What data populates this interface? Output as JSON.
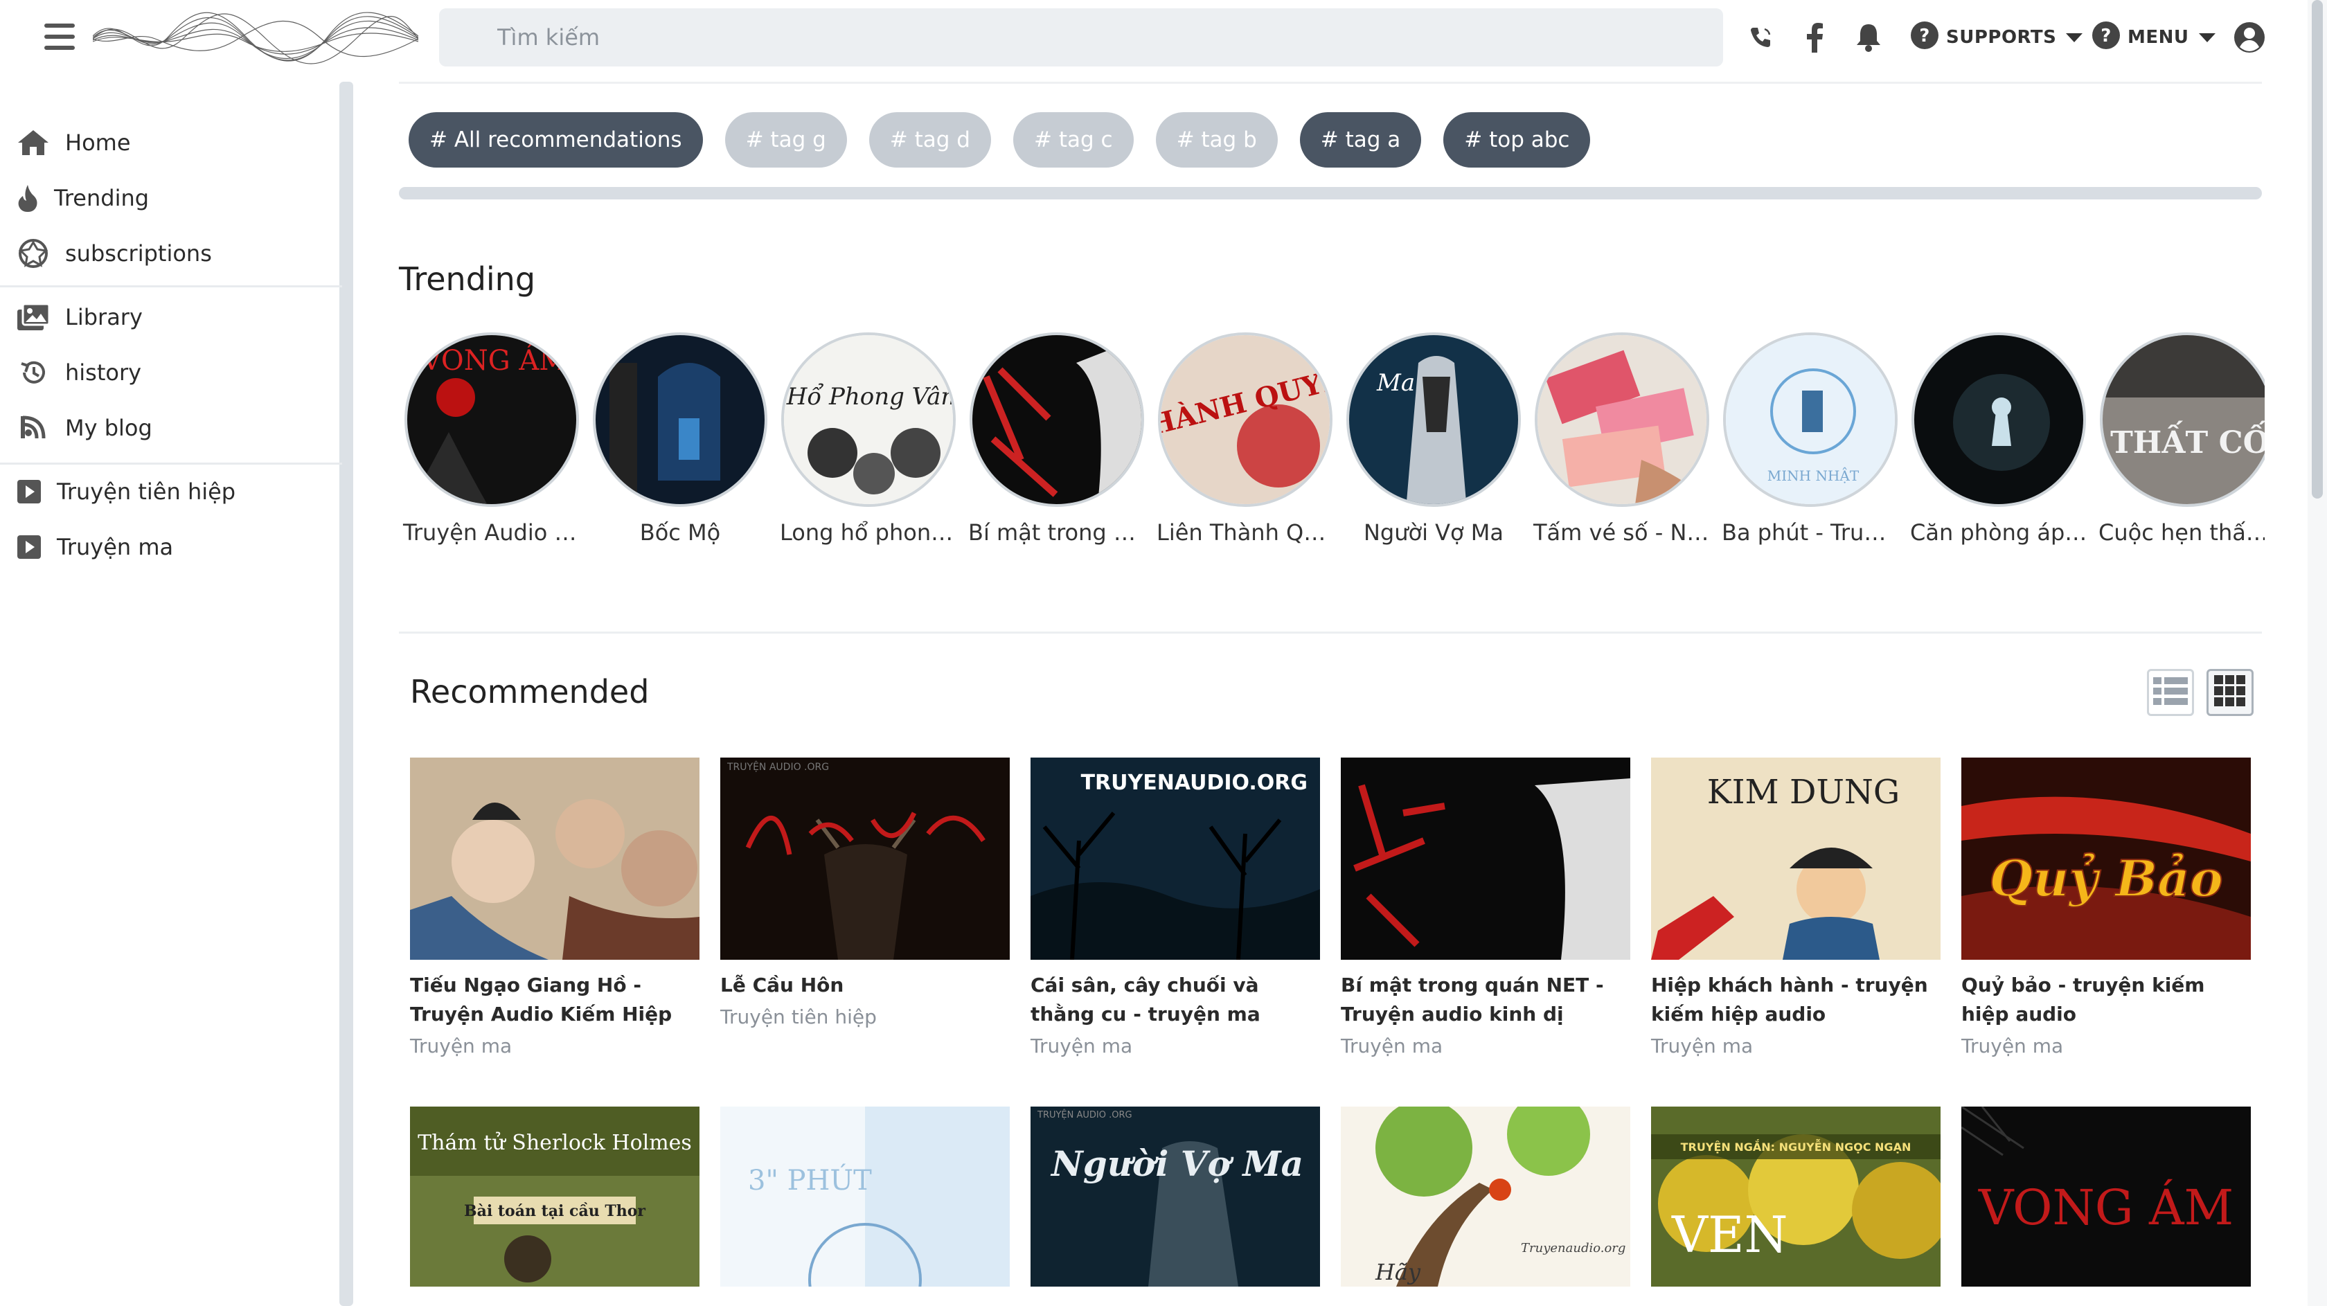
{
  "header": {
    "search_placeholder": "Tìm kiếm",
    "supports_label": "SUPPORTS",
    "menu_label": "MENU",
    "icons": [
      "menu-icon",
      "phone-icon",
      "facebook-icon",
      "bell-icon",
      "help-icon",
      "help-icon",
      "user-icon"
    ]
  },
  "sidebar": {
    "items": [
      {
        "label": "Home",
        "icon": "home-icon"
      },
      {
        "label": "Trending",
        "icon": "flame-icon"
      },
      {
        "label": "subscriptions",
        "icon": "subscriptions-icon"
      },
      {
        "label": "Library",
        "icon": "library-icon"
      },
      {
        "label": "history",
        "icon": "history-icon"
      },
      {
        "label": "My blog",
        "icon": "blog-icon"
      },
      {
        "label": "Truyện tiên hiệp",
        "icon": "play-icon"
      },
      {
        "label": "Truyện ma",
        "icon": "play-icon"
      }
    ]
  },
  "tags": [
    {
      "label": "# All recommendations",
      "style": "dark"
    },
    {
      "label": "# tag g",
      "style": "light"
    },
    {
      "label": "# tag d",
      "style": "light"
    },
    {
      "label": "# tag c",
      "style": "light"
    },
    {
      "label": "# tag b",
      "style": "light"
    },
    {
      "label": "# tag a",
      "style": "dark"
    },
    {
      "label": "# top abc",
      "style": "dark"
    }
  ],
  "trending": {
    "title": "Trending",
    "items": [
      {
        "label": "Truyện Audio ki...",
        "thumb_text": "VONG ÁM"
      },
      {
        "label": "Bốc Mộ",
        "thumb_text": ""
      },
      {
        "label": "Long hổ phong ...",
        "thumb_text": "Hổ Phong Vân"
      },
      {
        "label": "Bí mật trong qu...",
        "thumb_text": ""
      },
      {
        "label": "Liên Thành Quy...",
        "thumb_text": "THÀNH QUYẾT"
      },
      {
        "label": "Người Vợ Ma",
        "thumb_text": "Ma"
      },
      {
        "label": "Tấm vé số - Ng...",
        "thumb_text": ""
      },
      {
        "label": "Ba phút - Truyệ...",
        "thumb_text": "MINH NHẬT"
      },
      {
        "label": "Căn phòng áp ...",
        "thumb_text": ""
      },
      {
        "label": "Cuộc hẹn thất c...",
        "thumb_text": "THẤT CỐ"
      }
    ]
  },
  "recommended": {
    "title": "Recommended",
    "view_icons": [
      "list-view-icon",
      "grid-view-icon"
    ],
    "cards": [
      {
        "title": "Tiếu Ngạo Giang Hồ - Truyện Audio Kiếm Hiệp",
        "category": "Truyện ma",
        "thumb_text": ""
      },
      {
        "title": "Lễ Cầu Hôn",
        "category": "Truyện tiên hiệp",
        "thumb_text": "TRUYỆN AUDIO .ORG"
      },
      {
        "title": "Cái sân, cây chuối và thằng cu - truyện ma",
        "category": "Truyện ma",
        "thumb_text": "TRUYENAUDIO.ORG"
      },
      {
        "title": "Bí mật trong quán NET - Truyện audio kinh dị",
        "category": "Truyện ma",
        "thumb_text": ""
      },
      {
        "title": "Hiệp khách hành - truyện kiếm hiệp audio",
        "category": "Truyện ma",
        "thumb_text": "KIM DUNG"
      },
      {
        "title": "Quỷ bảo - truyện kiếm hiệp audio",
        "category": "Truyện ma",
        "thumb_text": "Quỷ Bảo"
      }
    ],
    "cards_row2": [
      {
        "thumb_text": "Thám tử Sherlock Holmes",
        "subtext": "Bài toán tại cầu Thor"
      },
      {
        "thumb_text": "3\" PHÚT",
        "subtext": ""
      },
      {
        "thumb_text": "Người Vợ Ma",
        "subtext": "TRUYỆN AUDIO .ORG"
      },
      {
        "thumb_text": "Hãy",
        "subtext": "Truyenaudio.org"
      },
      {
        "thumb_text": "VEN",
        "subtext": "TRUYỆN NGẮN: NGUYỄN NGỌC NGẠN"
      },
      {
        "thumb_text": "VONG ÁM",
        "subtext": ""
      }
    ]
  },
  "colors": {
    "tag_dark": "#4a5563",
    "tag_light": "#c6ccd3",
    "search_bg": "#eceff2",
    "sidebar_scroll": "#dce1e6"
  }
}
